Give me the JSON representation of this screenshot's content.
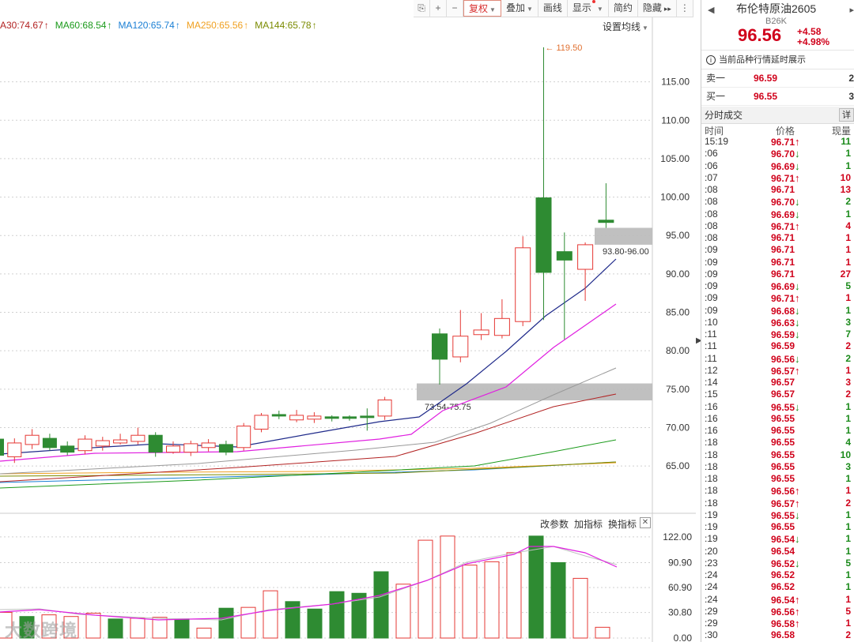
{
  "toolbar": {
    "buttons": [
      {
        "name": "ref-link-icon",
        "label": "⎘",
        "icon": true
      },
      {
        "name": "zoom-in-icon",
        "label": "+",
        "icon": true
      },
      {
        "name": "zoom-out-icon",
        "label": "−",
        "icon": true
      },
      {
        "name": "fuquan-button",
        "label": "复权",
        "caret": true,
        "active": true
      },
      {
        "name": "overlay-button",
        "label": "叠加",
        "caret": true
      },
      {
        "name": "draw-line-button",
        "label": "画线"
      },
      {
        "name": "display-button",
        "label": "显示",
        "caret": true,
        "dot": true
      },
      {
        "name": "simple-button",
        "label": "简约"
      },
      {
        "name": "hide-button",
        "label": "隐藏",
        "expand": "▸▸"
      },
      {
        "name": "more-icon",
        "label": "⋮",
        "icon": true
      }
    ]
  },
  "ma_legend": [
    {
      "label": "A30:74.67",
      "arrow": "↑",
      "color": "#b22222"
    },
    {
      "label": "MA60:68.54",
      "arrow": "↑",
      "color": "#1a9a1a"
    },
    {
      "label": "MA120:65.74",
      "arrow": "↑",
      "color": "#1a7fd4"
    },
    {
      "label": "MA250:65.56",
      "arrow": "↑",
      "color": "#f0a020"
    },
    {
      "label": "MA144:65.78",
      "arrow": "↑",
      "color": "#7a8a00"
    }
  ],
  "ma_settings": "设置均线",
  "price_axis": {
    "labels": [
      "115.00",
      "110.00",
      "105.00",
      "100.00",
      "95.00",
      "90.00",
      "85.00",
      "80.00",
      "75.00",
      "70.00",
      "65.00"
    ],
    "values": [
      115,
      110,
      105,
      100,
      95,
      90,
      85,
      80,
      75,
      70,
      65
    ]
  },
  "annotations": {
    "high_label": "119.50",
    "zone_upper_label": "93.80-96.00",
    "zone_lower_label": "73.54-75.75"
  },
  "zones": [
    {
      "low": 93.8,
      "high": 96.0
    },
    {
      "low": 73.54,
      "high": 75.75
    }
  ],
  "volume_axis": {
    "labels": [
      "122.00",
      "90.90",
      "60.90",
      "30.80",
      "0.00"
    ],
    "values": [
      122,
      90.9,
      60.9,
      30.8,
      0
    ]
  },
  "volume_tools": {
    "items": [
      "改参数",
      "加指标",
      "换指标"
    ],
    "close": "✕"
  },
  "watermark": "大数跨境",
  "colors": {
    "up": "#e53935",
    "down": "#2e8b32",
    "ma5": "#1f2a8a",
    "ma10": "#e020e0",
    "ma20": "#999999",
    "ma30": "#b22222",
    "ma60": "#1a9a1a",
    "ma120": "#1a7fd4",
    "ma250": "#f0a020",
    "ma144": "#7a8a00",
    "price": "#d0021b",
    "accent": "#e08a7a"
  },
  "chart_data": {
    "type": "candlestick",
    "candles": [
      {
        "o": 68.5,
        "c": 66.4,
        "h": 69.6,
        "l": 65.8
      },
      {
        "o": 66.2,
        "c": 68.0,
        "h": 68.6,
        "l": 65.4
      },
      {
        "o": 67.8,
        "c": 69.0,
        "h": 69.8,
        "l": 67.2
      },
      {
        "o": 68.6,
        "c": 67.4,
        "h": 69.2,
        "l": 67.0
      },
      {
        "o": 67.6,
        "c": 66.8,
        "h": 68.2,
        "l": 66.4
      },
      {
        "o": 67.0,
        "c": 68.5,
        "h": 69.0,
        "l": 66.5
      },
      {
        "o": 67.6,
        "c": 68.3,
        "h": 68.8,
        "l": 67.0
      },
      {
        "o": 68.0,
        "c": 68.4,
        "h": 69.2,
        "l": 67.8
      },
      {
        "o": 68.2,
        "c": 69.0,
        "h": 70.0,
        "l": 67.8
      },
      {
        "o": 69.0,
        "c": 66.8,
        "h": 69.4,
        "l": 66.2
      },
      {
        "o": 66.8,
        "c": 67.6,
        "h": 68.2,
        "l": 66.6
      },
      {
        "o": 66.8,
        "c": 67.9,
        "h": 68.3,
        "l": 66.3
      },
      {
        "o": 67.4,
        "c": 68.0,
        "h": 68.5,
        "l": 66.9
      },
      {
        "o": 67.8,
        "c": 66.8,
        "h": 68.3,
        "l": 66.4
      },
      {
        "o": 67.4,
        "c": 70.2,
        "h": 70.6,
        "l": 67.0
      },
      {
        "o": 69.8,
        "c": 71.6,
        "h": 71.9,
        "l": 69.4
      },
      {
        "o": 71.7,
        "c": 71.5,
        "h": 72.2,
        "l": 71.1
      },
      {
        "o": 71.0,
        "c": 71.6,
        "h": 72.3,
        "l": 70.7
      },
      {
        "o": 71.1,
        "c": 71.5,
        "h": 72.0,
        "l": 70.6
      },
      {
        "o": 71.4,
        "c": 71.2,
        "h": 71.6,
        "l": 70.8
      },
      {
        "o": 71.4,
        "c": 71.2,
        "h": 71.6,
        "l": 70.9
      },
      {
        "o": 71.5,
        "c": 71.3,
        "h": 72.5,
        "l": 69.6
      },
      {
        "o": 71.5,
        "c": 73.6,
        "h": 74.0,
        "l": 71.0
      },
      {
        "o": 82.2,
        "c": 78.9,
        "h": 82.9,
        "l": 75.6
      },
      {
        "o": 79.2,
        "c": 81.9,
        "h": 85.3,
        "l": 78.5
      },
      {
        "o": 82.1,
        "c": 82.7,
        "h": 84.9,
        "l": 81.4
      },
      {
        "o": 82.0,
        "c": 84.2,
        "h": 86.7,
        "l": 81.6
      },
      {
        "o": 83.8,
        "c": 93.4,
        "h": 94.9,
        "l": 83.2
      },
      {
        "o": 99.9,
        "c": 90.2,
        "h": 119.5,
        "l": 84.0
      },
      {
        "o": 92.9,
        "c": 91.8,
        "h": 95.4,
        "l": 81.5
      },
      {
        "o": 90.6,
        "c": 93.8,
        "h": 94.1,
        "l": 86.5
      },
      {
        "o": 97.0,
        "c": 96.7,
        "h": 101.8,
        "l": 96.0
      }
    ],
    "volume": [
      {
        "v": 31,
        "up": true
      },
      {
        "v": 26,
        "up": false
      },
      {
        "v": 28,
        "up": true
      },
      {
        "v": 26,
        "up": true
      },
      {
        "v": 30,
        "up": true
      },
      {
        "v": 23,
        "up": false
      },
      {
        "v": 24,
        "up": true
      },
      {
        "v": 25,
        "up": true
      },
      {
        "v": 23,
        "up": false
      },
      {
        "v": 12,
        "up": true
      },
      {
        "v": 36,
        "up": false
      },
      {
        "v": 37,
        "up": true
      },
      {
        "v": 57,
        "up": true
      },
      {
        "v": 44,
        "up": false
      },
      {
        "v": 35,
        "up": false
      },
      {
        "v": 56,
        "up": false
      },
      {
        "v": 54,
        "up": false
      },
      {
        "v": 80,
        "up": false
      },
      {
        "v": 65,
        "up": true
      },
      {
        "v": 118,
        "up": true
      },
      {
        "v": 123,
        "up": true
      },
      {
        "v": 88,
        "up": true
      },
      {
        "v": 92,
        "up": true
      },
      {
        "v": 103,
        "up": true
      },
      {
        "v": 123,
        "up": false
      },
      {
        "v": 91,
        "up": false
      },
      {
        "v": 72,
        "up": true
      },
      {
        "v": 13,
        "up": true
      }
    ],
    "yaxis_range": [
      60,
      122
    ],
    "volume_range": [
      0,
      130
    ]
  },
  "instrument": {
    "name": "布伦特原油2605",
    "code": "B26K",
    "price": "96.56",
    "change": "+4.58",
    "pct": "+4.98%",
    "prev": "◀",
    "next": "▸"
  },
  "delay_notice": "当前品种行情延时展示",
  "orderbook": [
    {
      "label": "卖一",
      "price": "96.59",
      "vol": "2"
    },
    {
      "label": "买一",
      "price": "96.55",
      "vol": "3"
    }
  ],
  "trades_title": "分时成交",
  "trades_detail": "详",
  "trades_header": {
    "time": "时间",
    "price": "价格",
    "vol": "现量"
  },
  "trades": [
    {
      "t": "15:19",
      "p": "96.71",
      "d": "u",
      "v": "11",
      "vc": "g"
    },
    {
      "t": ":06",
      "p": "96.70",
      "d": "d",
      "v": "1",
      "vc": "g"
    },
    {
      "t": ":06",
      "p": "96.69",
      "d": "d",
      "v": "1",
      "vc": "g"
    },
    {
      "t": ":07",
      "p": "96.71",
      "d": "u",
      "v": "10",
      "vc": "r"
    },
    {
      "t": ":08",
      "p": "96.71",
      "d": "",
      "v": "13",
      "vc": "r"
    },
    {
      "t": ":08",
      "p": "96.70",
      "d": "d",
      "v": "2",
      "vc": "g"
    },
    {
      "t": ":08",
      "p": "96.69",
      "d": "d",
      "v": "1",
      "vc": "g"
    },
    {
      "t": ":08",
      "p": "96.71",
      "d": "u",
      "v": "4",
      "vc": "r"
    },
    {
      "t": ":08",
      "p": "96.71",
      "d": "",
      "v": "1",
      "vc": "r"
    },
    {
      "t": ":09",
      "p": "96.71",
      "d": "",
      "v": "1",
      "vc": "r"
    },
    {
      "t": ":09",
      "p": "96.71",
      "d": "",
      "v": "1",
      "vc": "r"
    },
    {
      "t": ":09",
      "p": "96.71",
      "d": "",
      "v": "27",
      "vc": "r"
    },
    {
      "t": ":09",
      "p": "96.69",
      "d": "d",
      "v": "5",
      "vc": "g"
    },
    {
      "t": ":09",
      "p": "96.71",
      "d": "u",
      "v": "1",
      "vc": "r"
    },
    {
      "t": ":09",
      "p": "96.68",
      "d": "d",
      "v": "1",
      "vc": "g"
    },
    {
      "t": ":10",
      "p": "96.63",
      "d": "d",
      "v": "3",
      "vc": "g"
    },
    {
      "t": ":11",
      "p": "96.59",
      "d": "d",
      "v": "7",
      "vc": "g"
    },
    {
      "t": ":11",
      "p": "96.59",
      "d": "",
      "v": "2",
      "vc": "r"
    },
    {
      "t": ":11",
      "p": "96.56",
      "d": "d",
      "v": "2",
      "vc": "g"
    },
    {
      "t": ":12",
      "p": "96.57",
      "d": "u",
      "v": "1",
      "vc": "r"
    },
    {
      "t": ":14",
      "p": "96.57",
      "d": "",
      "v": "3",
      "vc": "r"
    },
    {
      "t": ":15",
      "p": "96.57",
      "d": "",
      "v": "2",
      "vc": "r"
    },
    {
      "t": ":16",
      "p": "96.55",
      "d": "d",
      "v": "1",
      "vc": "g"
    },
    {
      "t": ":16",
      "p": "96.55",
      "d": "",
      "v": "1",
      "vc": "g"
    },
    {
      "t": ":16",
      "p": "96.55",
      "d": "",
      "v": "1",
      "vc": "g"
    },
    {
      "t": ":18",
      "p": "96.55",
      "d": "",
      "v": "4",
      "vc": "g"
    },
    {
      "t": ":18",
      "p": "96.55",
      "d": "",
      "v": "10",
      "vc": "g"
    },
    {
      "t": ":18",
      "p": "96.55",
      "d": "",
      "v": "3",
      "vc": "g"
    },
    {
      "t": ":18",
      "p": "96.55",
      "d": "",
      "v": "1",
      "vc": "g"
    },
    {
      "t": ":18",
      "p": "96.56",
      "d": "u",
      "v": "1",
      "vc": "r"
    },
    {
      "t": ":18",
      "p": "96.57",
      "d": "u",
      "v": "2",
      "vc": "r"
    },
    {
      "t": ":19",
      "p": "96.55",
      "d": "d",
      "v": "1",
      "vc": "g"
    },
    {
      "t": ":19",
      "p": "96.55",
      "d": "",
      "v": "1",
      "vc": "g"
    },
    {
      "t": ":19",
      "p": "96.54",
      "d": "d",
      "v": "1",
      "vc": "g"
    },
    {
      "t": ":20",
      "p": "96.54",
      "d": "",
      "v": "1",
      "vc": "g"
    },
    {
      "t": ":23",
      "p": "96.52",
      "d": "d",
      "v": "5",
      "vc": "g"
    },
    {
      "t": ":24",
      "p": "96.52",
      "d": "",
      "v": "1",
      "vc": "g"
    },
    {
      "t": ":24",
      "p": "96.52",
      "d": "",
      "v": "1",
      "vc": "g"
    },
    {
      "t": ":24",
      "p": "96.54",
      "d": "u",
      "v": "1",
      "vc": "r"
    },
    {
      "t": ":29",
      "p": "96.56",
      "d": "u",
      "v": "5",
      "vc": "r"
    },
    {
      "t": ":29",
      "p": "96.58",
      "d": "u",
      "v": "1",
      "vc": "r"
    },
    {
      "t": ":30",
      "p": "96.58",
      "d": "",
      "v": "2",
      "vc": "r"
    }
  ]
}
